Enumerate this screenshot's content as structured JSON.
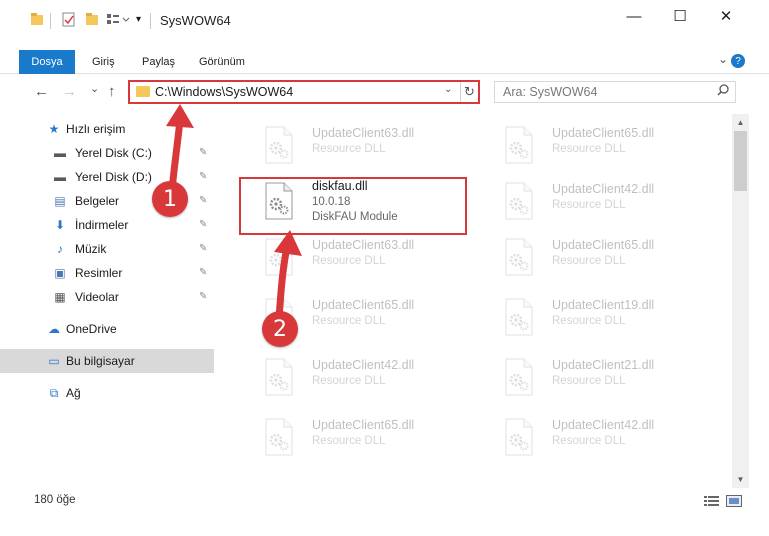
{
  "window": {
    "title": "SysWOW64",
    "minimize": "—",
    "maximize": "☐",
    "close": "✕"
  },
  "ribbon": {
    "tabs": [
      "Dosya",
      "Giriş",
      "Paylaş",
      "Görünüm"
    ],
    "expand": "⌄",
    "help": "?"
  },
  "nav": {
    "back": "←",
    "forward": "→",
    "recent": "⌄",
    "up": "↑",
    "address": "C:\\Windows\\SysWOW64",
    "address_dropdown": "⌄",
    "refresh": "↻",
    "search_placeholder": "Ara: SysWOW64",
    "search_icon": "⌕"
  },
  "sidebar": {
    "items": [
      {
        "label": "Hızlı erişim",
        "icon": "star-icon",
        "glyph": "★",
        "color": "#2b78c5"
      },
      {
        "label": "Yerel Disk (C:)",
        "icon": "drive-icon",
        "glyph": "▬",
        "color": "#5a5a5a"
      },
      {
        "label": "Yerel Disk (D:)",
        "icon": "drive-icon",
        "glyph": "▬",
        "color": "#5a5a5a"
      },
      {
        "label": "Belgeler",
        "icon": "documents-icon",
        "glyph": "▤",
        "color": "#4a79b5"
      },
      {
        "label": "İndirmeler",
        "icon": "downloads-icon",
        "glyph": "⬇",
        "color": "#2b78c5"
      },
      {
        "label": "Müzik",
        "icon": "music-icon",
        "glyph": "♪",
        "color": "#2b78c5"
      },
      {
        "label": "Resimler",
        "icon": "pictures-icon",
        "glyph": "▣",
        "color": "#4a79b5"
      },
      {
        "label": "Videolar",
        "icon": "videos-icon",
        "glyph": "▦",
        "color": "#555555"
      },
      {
        "label": "OneDrive",
        "icon": "cloud-icon",
        "glyph": "☁",
        "color": "#2b78c5"
      },
      {
        "label": "Bu bilgisayar",
        "icon": "computer-icon",
        "glyph": "▭",
        "color": "#2b78c5"
      },
      {
        "label": "Ağ",
        "icon": "network-icon",
        "glyph": "⧉",
        "color": "#2b78c5"
      }
    ],
    "pin_glyph": "✎"
  },
  "files": [
    {
      "name": "UpdateClient63.dll",
      "type": "Resource DLL"
    },
    {
      "name": "UpdateClient65.dll",
      "type": "Resource DLL"
    },
    {
      "name": "diskfau.dll",
      "version": "10.0.18",
      "description": "DiskFAU Module"
    },
    {
      "name": "UpdateClient42.dll",
      "type": "Resource DLL"
    },
    {
      "name": "UpdateClient63.dll",
      "type": "Resource DLL"
    },
    {
      "name": "UpdateClient65.dll",
      "type": "Resource DLL"
    },
    {
      "name": "UpdateClient65.dll",
      "type": "Resource DLL"
    },
    {
      "name": "UpdateClient19.dll",
      "type": "Resource DLL"
    },
    {
      "name": "UpdateClient42.dll",
      "type": "Resource DLL"
    },
    {
      "name": "UpdateClient21.dll",
      "type": "Resource DLL"
    },
    {
      "name": "UpdateClient65.dll",
      "type": "Resource DLL"
    },
    {
      "name": "UpdateClient42.dll",
      "type": "Resource DLL"
    }
  ],
  "status": {
    "item_count": "180 öğe"
  },
  "callouts": [
    "1",
    "2"
  ],
  "colors": {
    "highlight": "#d8383a",
    "file_tab": "#1979ca",
    "selected": "#d9d9d9"
  }
}
